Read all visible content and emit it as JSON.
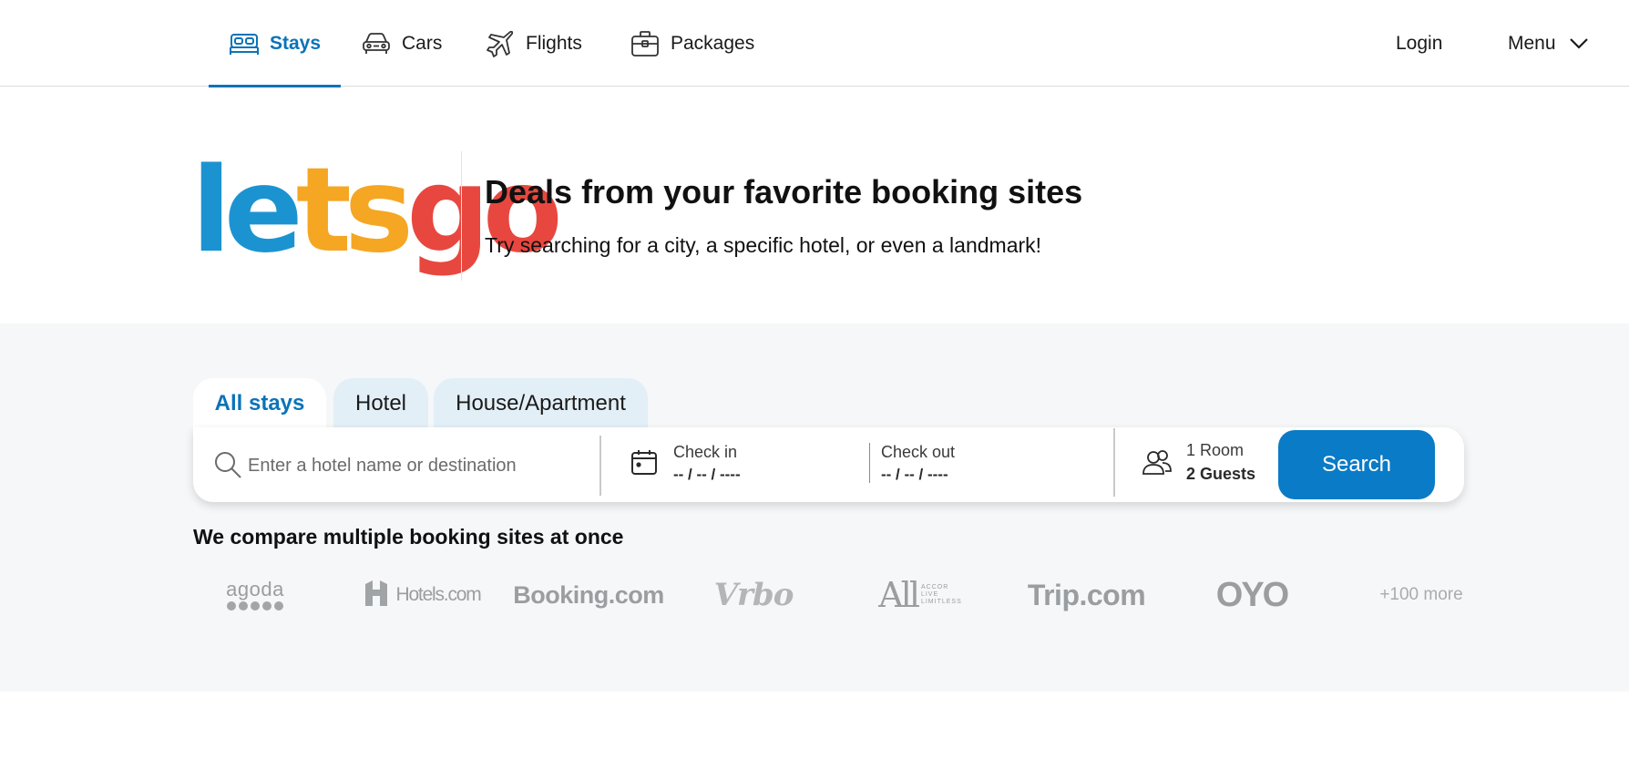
{
  "nav": {
    "items": [
      {
        "label": "Stays",
        "icon": "bed-icon",
        "active": true
      },
      {
        "label": "Cars",
        "icon": "car-icon",
        "active": false
      },
      {
        "label": "Flights",
        "icon": "plane-icon",
        "active": false
      },
      {
        "label": "Packages",
        "icon": "briefcase-icon",
        "active": false
      }
    ],
    "login_label": "Login",
    "menu_label": "Menu"
  },
  "hero": {
    "logo": {
      "part1": "le",
      "part2": "ts",
      "part3": "go"
    },
    "title": "Deals from your favorite booking sites",
    "subtitle": "Try searching for a city, a specific hotel, or even a landmark!"
  },
  "search": {
    "tabs": [
      {
        "label": "All stays",
        "active": true
      },
      {
        "label": "Hotel",
        "active": false
      },
      {
        "label": "House/Apartment",
        "active": false
      }
    ],
    "destination_placeholder": "Enter a hotel name or destination",
    "checkin": {
      "label": "Check in",
      "value": "-- / -- / ----"
    },
    "checkout": {
      "label": "Check out",
      "value": "-- / -- / ----"
    },
    "guests": {
      "rooms": "1 Room",
      "guests": "2 Guests"
    },
    "button_label": "Search"
  },
  "partners": {
    "title": "We compare multiple booking sites at once",
    "logos": [
      "agoda",
      "Hotels.com",
      "Booking.com",
      "Vrbo",
      "All",
      "Trip.com",
      "OYO"
    ],
    "all_small": [
      "ACCOR",
      "LIVE",
      "LIMITLESS"
    ],
    "more_label": "+100 more"
  },
  "colors": {
    "accent": "#0a73b8",
    "search_button": "#0a7bc6",
    "logo_blue": "#1c93d1",
    "logo_orange": "#f5a623",
    "logo_red": "#e8473f",
    "section_bg": "#f5f7f8",
    "tab_inactive_bg": "#e3eff7"
  }
}
